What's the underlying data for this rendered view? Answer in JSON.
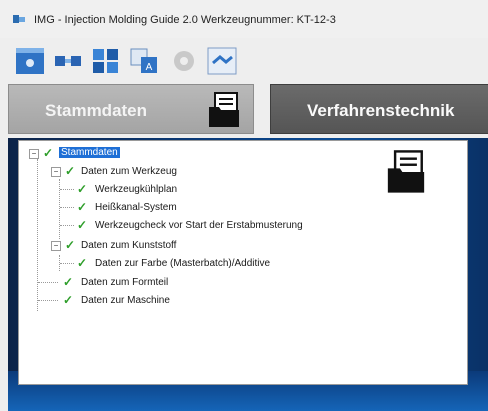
{
  "window": {
    "title": "IMG - Injection Molding Guide 2.0    Werkzeugnummer: KT-12-3"
  },
  "toolbar": {
    "buttons": [
      {
        "icon": "settings-icon"
      },
      {
        "icon": "mold-icon"
      },
      {
        "icon": "puzzle-icon"
      },
      {
        "icon": "translate-icon"
      },
      {
        "icon": "gear-disabled-icon"
      },
      {
        "icon": "handshake-icon"
      }
    ]
  },
  "tabs": [
    {
      "label": "Stammdaten"
    },
    {
      "label": "Verfahrenstechnik"
    }
  ],
  "tree": {
    "root": "Stammdaten",
    "items": [
      {
        "label": "Daten zum Werkzeug"
      },
      {
        "label": "Werkzeugkühlplan"
      },
      {
        "label": "Heißkanal-System"
      },
      {
        "label": "Werkzeugcheck vor Start der Erstabmusterung"
      },
      {
        "label": "Daten zum Kunststoff"
      },
      {
        "label": "Daten zur Farbe (Masterbatch)/Additive"
      },
      {
        "label": "Daten zum Formteil"
      },
      {
        "label": "Daten zur Maschine"
      }
    ],
    "expand_symbol": "−",
    "check_symbol": "✓"
  },
  "colors": {
    "selected": "#1e6fd6",
    "check": "#2e9e2a"
  }
}
